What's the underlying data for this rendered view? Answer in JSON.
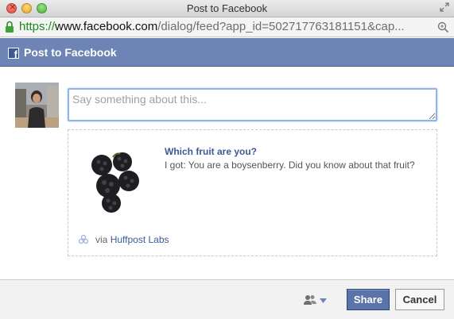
{
  "window": {
    "title": "Post to Facebook"
  },
  "address_bar": {
    "scheme": "https://",
    "host": "www.facebook.com",
    "path": "/dialog/feed?app_id=502717763181151&cap..."
  },
  "header": {
    "title": "Post to Facebook"
  },
  "composer": {
    "placeholder": "Say something about this...",
    "value": ""
  },
  "attachment": {
    "title": "Which fruit are you?",
    "description": "I got: You are a boysenberry. Did you know about that fruit?",
    "via_prefix": "via",
    "app_name": "Huffpost Labs"
  },
  "footer": {
    "share_label": "Share",
    "cancel_label": "Cancel"
  },
  "icons": {
    "secure": "lock-icon",
    "zoom": "zoom-icon",
    "logo": "facebook-logo-icon",
    "audience": "friends-icon",
    "dropdown": "caret-down-icon",
    "app": "app-icon"
  },
  "colors": {
    "fb_header": "#6d84b4",
    "fb_blue": "#3b5998",
    "share_button": "#5b74a8",
    "url_secure_green": "#1a8a1a"
  }
}
